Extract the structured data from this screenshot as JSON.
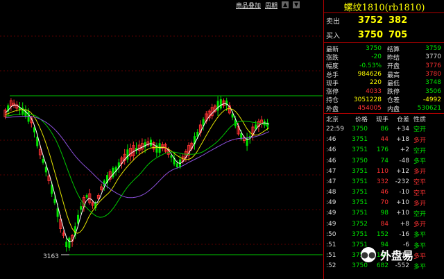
{
  "toolbar": {
    "btn1": "商品叠加",
    "btn2": "周期",
    "arrow_up": "▲",
    "arrow_down": "▼"
  },
  "chart": {
    "support_label": "3163"
  },
  "panel": {
    "title": "螺纹1810(rb1810)",
    "sell": {
      "label": "卖出",
      "price": "3752",
      "vol": "382"
    },
    "buy": {
      "label": "买入",
      "price": "3750",
      "vol": "705"
    },
    "stats": [
      {
        "l1": "最新",
        "v1": "3750",
        "c1": "dn",
        "l2": "结算",
        "v2": "3759",
        "c2": "dn"
      },
      {
        "l1": "涨跌",
        "v1": "-20",
        "c1": "dn",
        "l2": "昨结",
        "v2": "3770",
        "c2": "wh"
      },
      {
        "l1": "幅度",
        "v1": "-0.53%",
        "c1": "dn",
        "l2": "开盘",
        "v2": "3776",
        "c2": "up"
      },
      {
        "l1": "总手",
        "v1": "984626",
        "c1": "yl",
        "l2": "最高",
        "v2": "3780",
        "c2": "up"
      },
      {
        "l1": "现手",
        "v1": "220",
        "c1": "yl",
        "l2": "最低",
        "v2": "3748",
        "c2": "dn"
      },
      {
        "l1": "涨停",
        "v1": "4033",
        "c1": "up",
        "l2": "跌停",
        "v2": "3506",
        "c2": "dn"
      },
      {
        "l1": "持仓",
        "v1": "3051228",
        "c1": "yl",
        "l2": "仓差",
        "v2": "-4992",
        "c2": "yl"
      },
      {
        "l1": "外盘",
        "v1": "454005",
        "c1": "up",
        "l2": "内盘",
        "v2": "530621",
        "c2": "dn"
      }
    ],
    "table_headers": [
      "北京",
      "价格",
      "现手",
      "仓差",
      "性质"
    ],
    "ticks": [
      {
        "time": "22:59",
        "price": "3750",
        "pc": "dn",
        "vol": "86",
        "vc": "dn",
        "diff": "+34",
        "nature": "空开",
        "nc": "dn"
      },
      {
        "time": ":46",
        "price": "3751",
        "pc": "dn",
        "vol": "44",
        "vc": "up",
        "diff": "+18",
        "nature": "多开",
        "nc": "up"
      },
      {
        "time": ":46",
        "price": "3751",
        "pc": "dn",
        "vol": "176",
        "vc": "dn",
        "diff": "+2",
        "nature": "空开",
        "nc": "dn"
      },
      {
        "time": ":46",
        "price": "3750",
        "pc": "dn",
        "vol": "74",
        "vc": "dn",
        "diff": "-48",
        "nature": "多平",
        "nc": "dn"
      },
      {
        "time": ":47",
        "price": "3751",
        "pc": "dn",
        "vol": "110",
        "vc": "up",
        "diff": "+12",
        "nature": "多开",
        "nc": "up"
      },
      {
        "time": ":47",
        "price": "3751",
        "pc": "dn",
        "vol": "332",
        "vc": "up",
        "diff": "-232",
        "nature": "空平",
        "nc": "up"
      },
      {
        "time": ":48",
        "price": "3751",
        "pc": "dn",
        "vol": "46",
        "vc": "up",
        "diff": "-10",
        "nature": "空平",
        "nc": "up"
      },
      {
        "time": ":49",
        "price": "3751",
        "pc": "dn",
        "vol": "70",
        "vc": "up",
        "diff": "+10",
        "nature": "多开",
        "nc": "up"
      },
      {
        "time": ":49",
        "price": "3751",
        "pc": "dn",
        "vol": "98",
        "vc": "dn",
        "diff": "+10",
        "nature": "空开",
        "nc": "dn"
      },
      {
        "time": ":49",
        "price": "3752",
        "pc": "dn",
        "vol": "84",
        "vc": "up",
        "diff": "+8",
        "nature": "多开",
        "nc": "up"
      },
      {
        "time": ":50",
        "price": "3751",
        "pc": "dn",
        "vol": "152",
        "vc": "dn",
        "diff": "-16",
        "nature": "多平",
        "nc": "dn"
      },
      {
        "time": ":51",
        "price": "3751",
        "pc": "dn",
        "vol": "94",
        "vc": "dn",
        "diff": "-6",
        "nature": "多平",
        "nc": "dn"
      },
      {
        "time": ":51",
        "price": "3751",
        "pc": "dn",
        "vol": "154",
        "vc": "dn",
        "diff": "-14",
        "nature": "多平",
        "nc": "up"
      },
      {
        "time": ":52",
        "price": "3750",
        "pc": "dn",
        "vol": "682",
        "vc": "dn",
        "diff": "-552",
        "nature": "多平",
        "nc": "dn"
      }
    ]
  },
  "watermark": {
    "text": "外盘易",
    "icon": "wechat-logo"
  },
  "colors": {
    "up": "#ff3232",
    "down": "#00e600",
    "ma_yellow": "#e6e600",
    "ma_green": "#00c800",
    "ma_purple": "#8c50dc",
    "ma_white": "#ffffff",
    "border": "#b00000"
  }
}
